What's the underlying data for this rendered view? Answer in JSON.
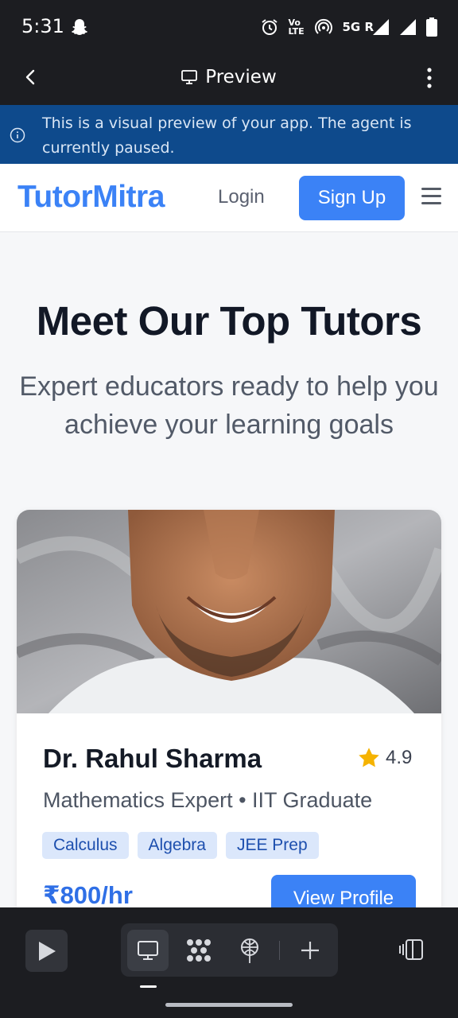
{
  "status_bar": {
    "time": "5:31",
    "volte": "Vo LTE",
    "network": "5G R"
  },
  "app_bar": {
    "title": "Preview"
  },
  "banner": {
    "message": "This is a visual preview of your app. The agent is currently paused."
  },
  "site": {
    "brand": "TutorMitra",
    "nav": {
      "login": "Login",
      "signup": "Sign Up"
    },
    "heading": "Meet Our Top Tutors",
    "subheading": "Expert educators ready to help you achieve your learning goals",
    "tutor": {
      "name": "Dr. Rahul Sharma",
      "rating": "4.9",
      "role": "Mathematics Expert • IIT Graduate",
      "tags": [
        "Calculus",
        "Algebra",
        "JEE Prep"
      ],
      "price": "₹800/hr",
      "cta": "View Profile"
    }
  },
  "colors": {
    "brand_blue": "#3b82f6",
    "banner_blue": "#0e4a8c",
    "dark_chrome": "#1c1d21",
    "star": "#f5b301"
  },
  "icons": [
    "snapchat-ghost-icon",
    "alarm-icon",
    "hotspot-icon",
    "signal-icon",
    "battery-icon",
    "back-arrow-icon",
    "monitor-icon",
    "kebab-menu-icon",
    "info-icon",
    "hamburger-icon",
    "star-icon",
    "play-icon",
    "preview-monitor-icon",
    "workflow-icon",
    "deploy-icon",
    "add-icon",
    "panel-toggle-icon"
  ]
}
